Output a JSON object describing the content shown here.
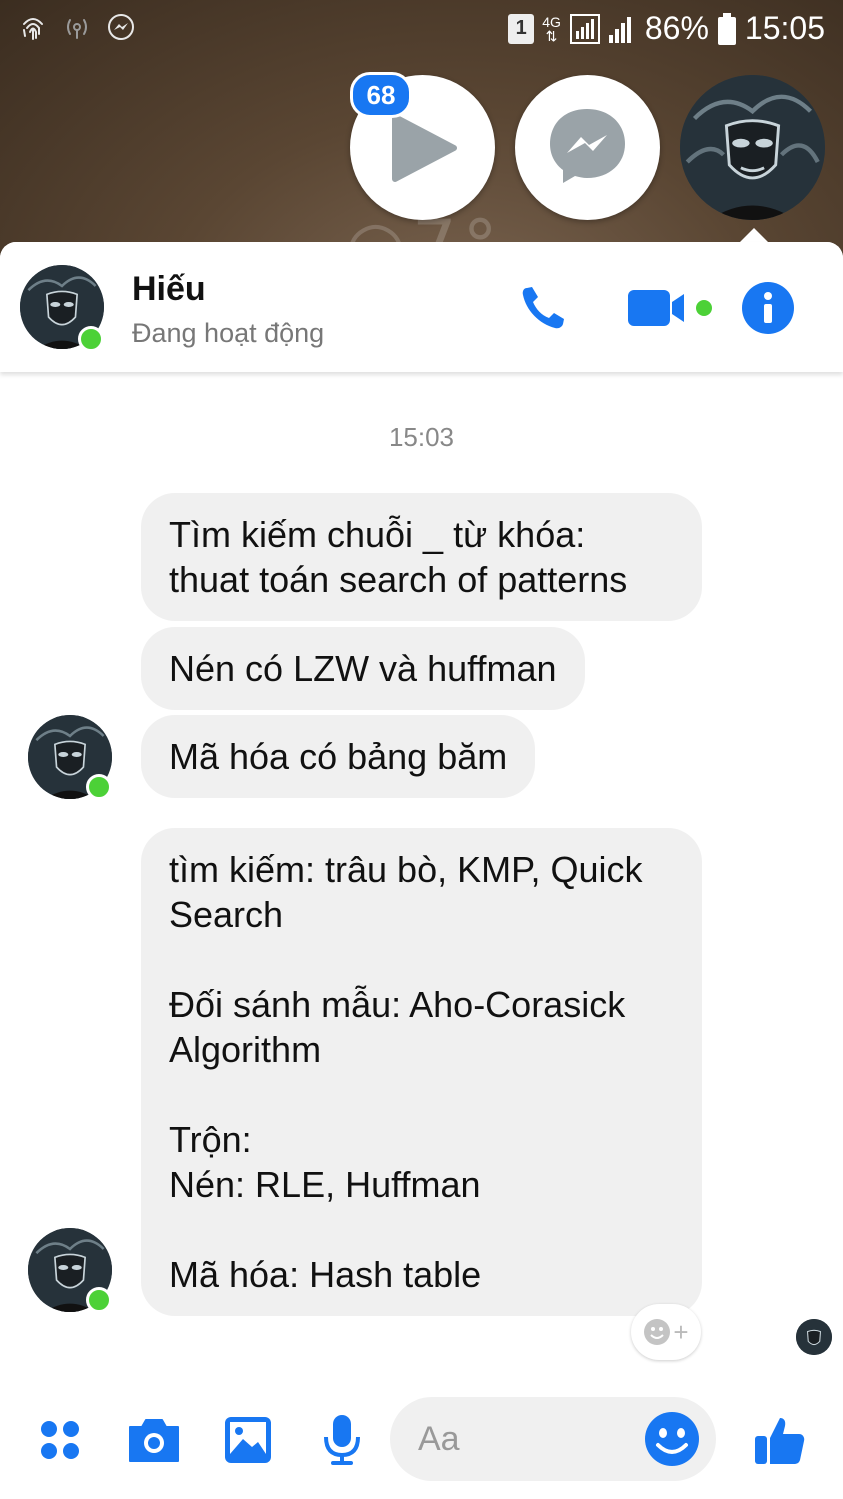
{
  "status_bar": {
    "sim_slot": "1",
    "network_type": "4G",
    "battery_percent": "86%",
    "time": "15:05",
    "icons": [
      "fingerprint-icon",
      "hotspot-icon",
      "messenger-icon",
      "sim-icon",
      "signal-icon",
      "battery-icon"
    ]
  },
  "chat_heads": {
    "unread_count": "68",
    "icons": [
      "play-icon",
      "messenger-icon",
      "avatar"
    ]
  },
  "header": {
    "name": "Hiếu",
    "status": "Đang hoạt động",
    "icons": [
      "phone-icon",
      "video-call-icon",
      "info-icon"
    ]
  },
  "conversation": {
    "timestamp": "15:03",
    "messages": [
      {
        "text": "Tìm kiếm chuỗi _ từ khóa:\nthuat toán search of patterns"
      },
      {
        "text": "Nén có LZW và huffman"
      },
      {
        "text": "Mã hóa có bảng băm"
      },
      {
        "text": "tìm kiếm: trâu bò, KMP, Quick\nSearch\n\nĐối sánh mẫu: Aho-Corasick\nAlgorithm\n\nTrộn:\nNén: RLE,  Huffman\n\nMã hóa: Hash table"
      }
    ]
  },
  "composer": {
    "placeholder": "Aa",
    "icons": [
      "apps-icon",
      "camera-icon",
      "gallery-icon",
      "microphone-icon",
      "emoji-icon",
      "like-icon"
    ]
  },
  "colors": {
    "accent": "#1877f2",
    "online": "#4cd137",
    "bubble": "#f0f0f0"
  }
}
